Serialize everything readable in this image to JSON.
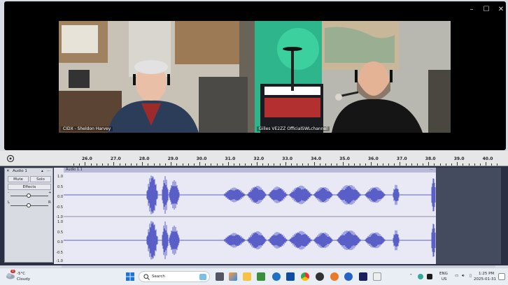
{
  "video_call": {
    "participants": [
      {
        "name": "CIDX - Sheldon Harvey"
      },
      {
        "name": "Gilles VE2ZZ OfficialSWLchannel"
      }
    ],
    "controls": {
      "minimize": "–",
      "maximize": "☐",
      "close": "✕"
    }
  },
  "ruler": {
    "ticks": [
      "26.0",
      "27.0",
      "28.0",
      "29.0",
      "30.0",
      "31.0",
      "32.0",
      "33.0",
      "34.0",
      "35.0",
      "36.0",
      "37.0",
      "38.0",
      "39.0",
      "40.0"
    ]
  },
  "track": {
    "name": "Audio 1",
    "clip_name": "Audio 1.1",
    "mute_label": "Mute",
    "solo_label": "Solo",
    "effects_label": "Effects",
    "pan_left": "L",
    "pan_right": "R",
    "gain_minus": "-",
    "gain_plus": "+",
    "scale_labels": [
      "1.0",
      "0.5",
      "0.0",
      "-0.5",
      "-1.0"
    ]
  },
  "taskbar": {
    "weather_temp": "-5°C",
    "weather_text": "Cloudy",
    "weather_badge": "1",
    "search_placeholder": "Search",
    "lang_top": "ENG",
    "lang_bottom": "US",
    "time": "1:25 PM",
    "date": "2025-01-31"
  },
  "colors": {
    "waveform": "#5a5fc8",
    "track_bg": "#e8e9f5",
    "timeline_bg": "#2a2f43"
  }
}
